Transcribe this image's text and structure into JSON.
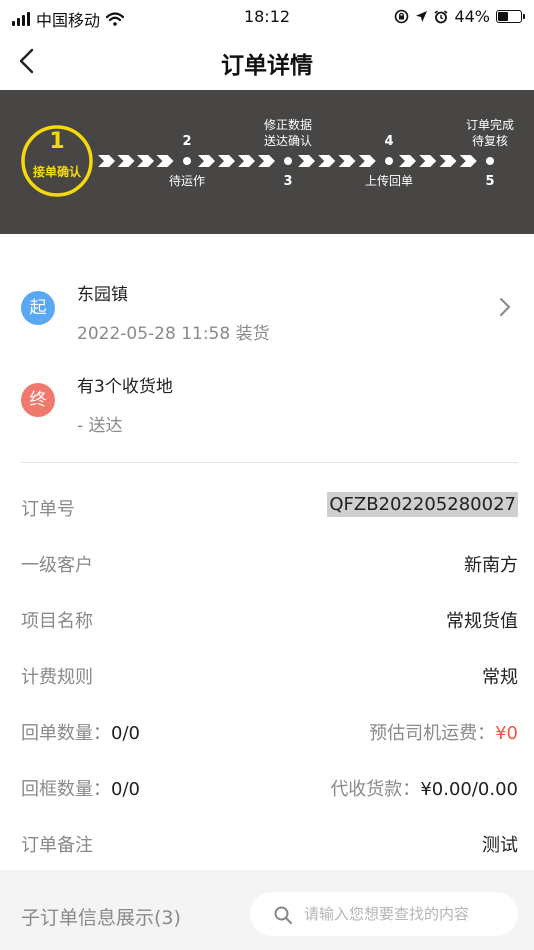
{
  "status_bar": {
    "carrier": "中国移动",
    "time": "18:12",
    "battery": "44%",
    "battery_level": 0.44
  },
  "nav": {
    "title": "订单详情"
  },
  "progress": {
    "current_step": 1,
    "steps": [
      {
        "number": "1",
        "label": "接单确认"
      },
      {
        "number": "2",
        "label": "待运作"
      },
      {
        "number": "3",
        "label": "修正数据\n送达确认"
      },
      {
        "number": "4",
        "label": "上传回单"
      },
      {
        "number": "5",
        "label": "订单完成\n待复核"
      }
    ],
    "step3_line1": "修正数据",
    "step3_line2": "送达确认",
    "step5_line1": "订单完成",
    "step5_line2": "待复核"
  },
  "route": {
    "start_badge": "起",
    "start_place": "东园镇",
    "start_detail": "2022-05-28 11:58 装货",
    "end_badge": "终",
    "end_place": "有3个收货地",
    "end_detail": "- 送达"
  },
  "info": {
    "order_no_label": "订单号",
    "order_no": "QFZB202205280027",
    "customer_label": "一级客户",
    "customer": "新南方",
    "project_label": "项目名称",
    "project": "常规货值",
    "billing_label": "计费规则",
    "billing": "常规",
    "receipt_label": "回单数量：",
    "receipt_value": "0/0",
    "freight_label": "预估司机运费：",
    "freight_value": "¥0",
    "frame_label": "回框数量：",
    "frame_value": "0/0",
    "cod_label": "代收货款：",
    "cod_value": "¥0.00/0.00",
    "remark_label": "订单备注",
    "remark": "测试"
  },
  "suborders": {
    "title": "子订单信息展示(3)",
    "search_placeholder": "请输入您想要查找的内容"
  },
  "colors": {
    "banner_bg": "#484644",
    "step_active": "#f5d90a",
    "start_badge": "#5aa7f3",
    "end_badge": "#f0786c",
    "freight_red": "#f05545"
  }
}
